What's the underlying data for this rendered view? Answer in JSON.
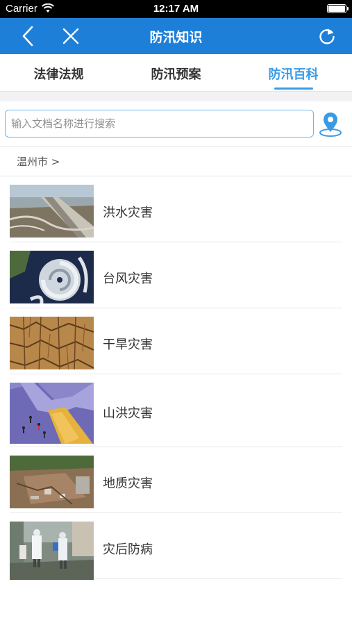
{
  "status_bar": {
    "carrier": "Carrier",
    "time": "12:17 AM"
  },
  "nav": {
    "title": "防汛知识",
    "back_icon": "chevron-left-icon",
    "close_icon": "close-icon",
    "refresh_icon": "refresh-icon"
  },
  "tabs": [
    {
      "label": "法律法规",
      "active": false
    },
    {
      "label": "防汛预案",
      "active": false
    },
    {
      "label": "防汛百科",
      "active": true
    }
  ],
  "search": {
    "placeholder": "输入文档名称进行搜索",
    "value": "",
    "location_icon": "location-pin-icon"
  },
  "breadcrumb": {
    "text": "温州市 >"
  },
  "accent_color": "#1e7fd9",
  "active_tab_color": "#3a9be5",
  "items": [
    {
      "label": "洪水灾害",
      "image": "flood-photo"
    },
    {
      "label": "台风灾害",
      "image": "typhoon-satellite-photo"
    },
    {
      "label": "干旱灾害",
      "image": "drought-cracked-earth-photo"
    },
    {
      "label": "山洪灾害",
      "image": "flash-flood-illustration"
    },
    {
      "label": "地质灾害",
      "image": "landslide-photo"
    },
    {
      "label": "灾后防病",
      "image": "disinfection-workers-photo"
    }
  ]
}
